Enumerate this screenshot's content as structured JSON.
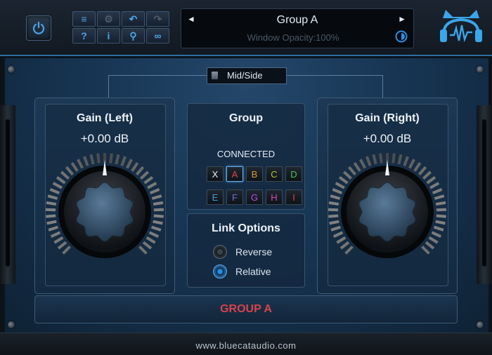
{
  "toolbar": {
    "row1": [
      "≡",
      "⚙",
      "↶",
      "↷"
    ],
    "row2": [
      "?",
      "i",
      "⚲",
      "∞"
    ],
    "icons": [
      "menu-icon",
      "settings-icon",
      "undo-icon",
      "redo-icon",
      "help-icon",
      "info-icon",
      "zoom-icon",
      "link-icon"
    ]
  },
  "preset": {
    "title": "Group A",
    "subtitle": "Window Opacity:100%",
    "prev_symbol": "◄",
    "next_symbol": "►"
  },
  "mid_side": {
    "label": "Mid/Side"
  },
  "gain_left": {
    "title": "Gain (Left)",
    "value": "+0.00 dB"
  },
  "gain_right": {
    "title": "Gain (Right)",
    "value": "+0.00 dB"
  },
  "group": {
    "title": "Group",
    "status": "CONNECTED",
    "channels": [
      {
        "label": "X",
        "color": "#e8eef3",
        "selected": false
      },
      {
        "label": "A",
        "color": "#e0454c",
        "selected": true
      },
      {
        "label": "B",
        "color": "#d89a3a",
        "selected": false
      },
      {
        "label": "C",
        "color": "#b7c23c",
        "selected": false
      },
      {
        "label": "D",
        "color": "#55c24a",
        "selected": false
      },
      {
        "label": "E",
        "color": "#3f9bd8",
        "selected": false
      },
      {
        "label": "F",
        "color": "#6b6ee0",
        "selected": false
      },
      {
        "label": "G",
        "color": "#b64fdc",
        "selected": false
      },
      {
        "label": "H",
        "color": "#d849b0",
        "selected": false
      },
      {
        "label": "I",
        "color": "#d8454a",
        "selected": false
      }
    ]
  },
  "link_options": {
    "title": "Link Options",
    "reverse": {
      "label": "Reverse",
      "checked": false
    },
    "relative": {
      "label": "Relative",
      "checked": true
    }
  },
  "status_bar": {
    "text": "GROUP A"
  },
  "footer": {
    "url": "www.bluecataudio.com"
  },
  "colors": {
    "accent": "#4fa3e8",
    "group_label": "#d8434b",
    "panel_bg": "#173553"
  }
}
